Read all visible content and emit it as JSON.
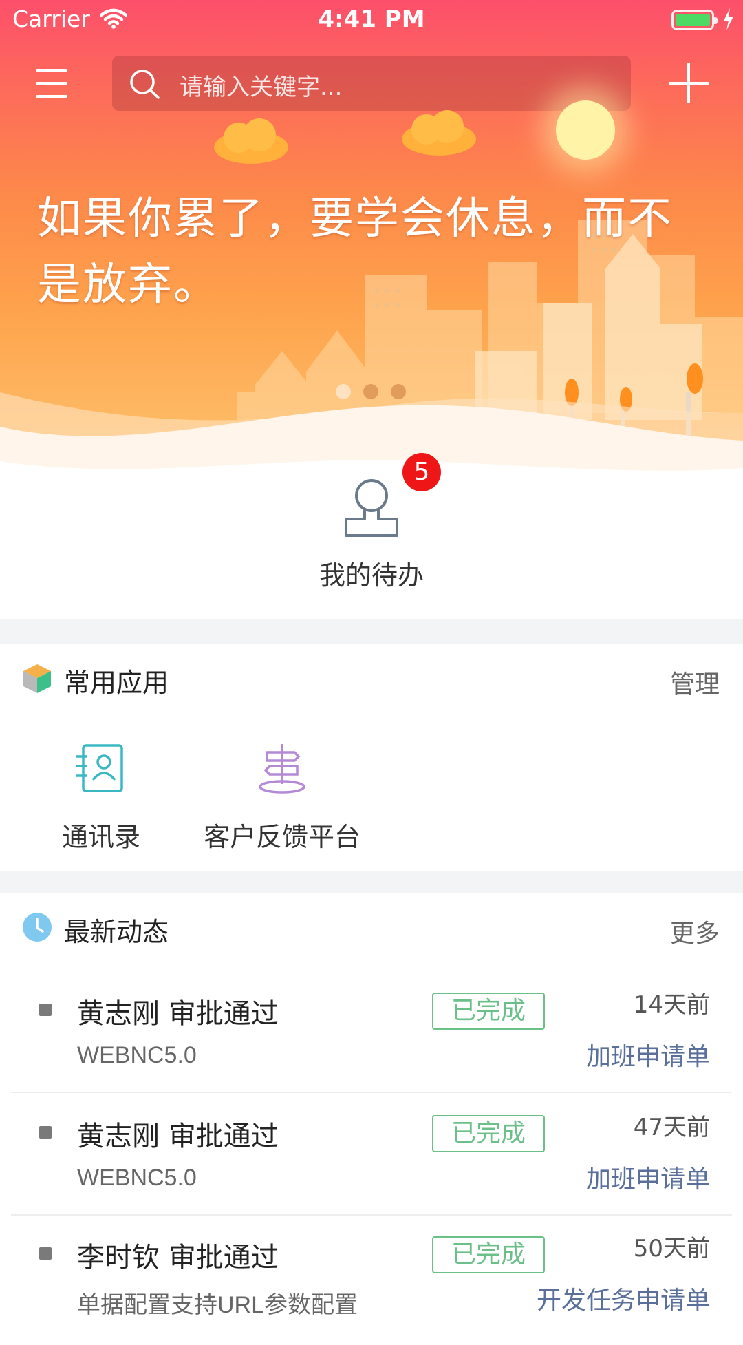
{
  "status_bar": {
    "carrier": "Carrier",
    "time": "4:41 PM"
  },
  "search": {
    "placeholder": "请输入关键字..."
  },
  "banner": {
    "quote": "如果你累了，要学会休息，而不是放弃。"
  },
  "todo": {
    "label": "我的待办",
    "badge": "5"
  },
  "common_apps": {
    "title": "常用应用",
    "manage_label": "管理",
    "apps": [
      {
        "label": "通讯录",
        "icon": "contacts-icon",
        "color": "#3bb8c4"
      },
      {
        "label": "客户反馈平台",
        "icon": "signpost-icon",
        "color": "#b48ad6"
      }
    ]
  },
  "news": {
    "title": "最新动态",
    "more_label": "更多",
    "items": [
      {
        "title": "黄志刚 审批通过",
        "subtitle": "WEBNC5.0",
        "status": "已完成",
        "time": "14天前",
        "type": "加班申请单"
      },
      {
        "title": "黄志刚 审批通过",
        "subtitle": "WEBNC5.0",
        "status": "已完成",
        "time": "47天前",
        "type": "加班申请单"
      },
      {
        "title": "李时钦 审批通过",
        "subtitle": "单据配置支持URL参数配置",
        "status": "已完成",
        "time": "50天前",
        "type": "开发任务申请单"
      }
    ]
  },
  "colors": {
    "accent_top": "#fd4f6b",
    "accent_bottom": "#ffc872",
    "status_green": "#6bc08a",
    "badge_red": "#ee1616",
    "link_blue": "#5a6f9a"
  }
}
